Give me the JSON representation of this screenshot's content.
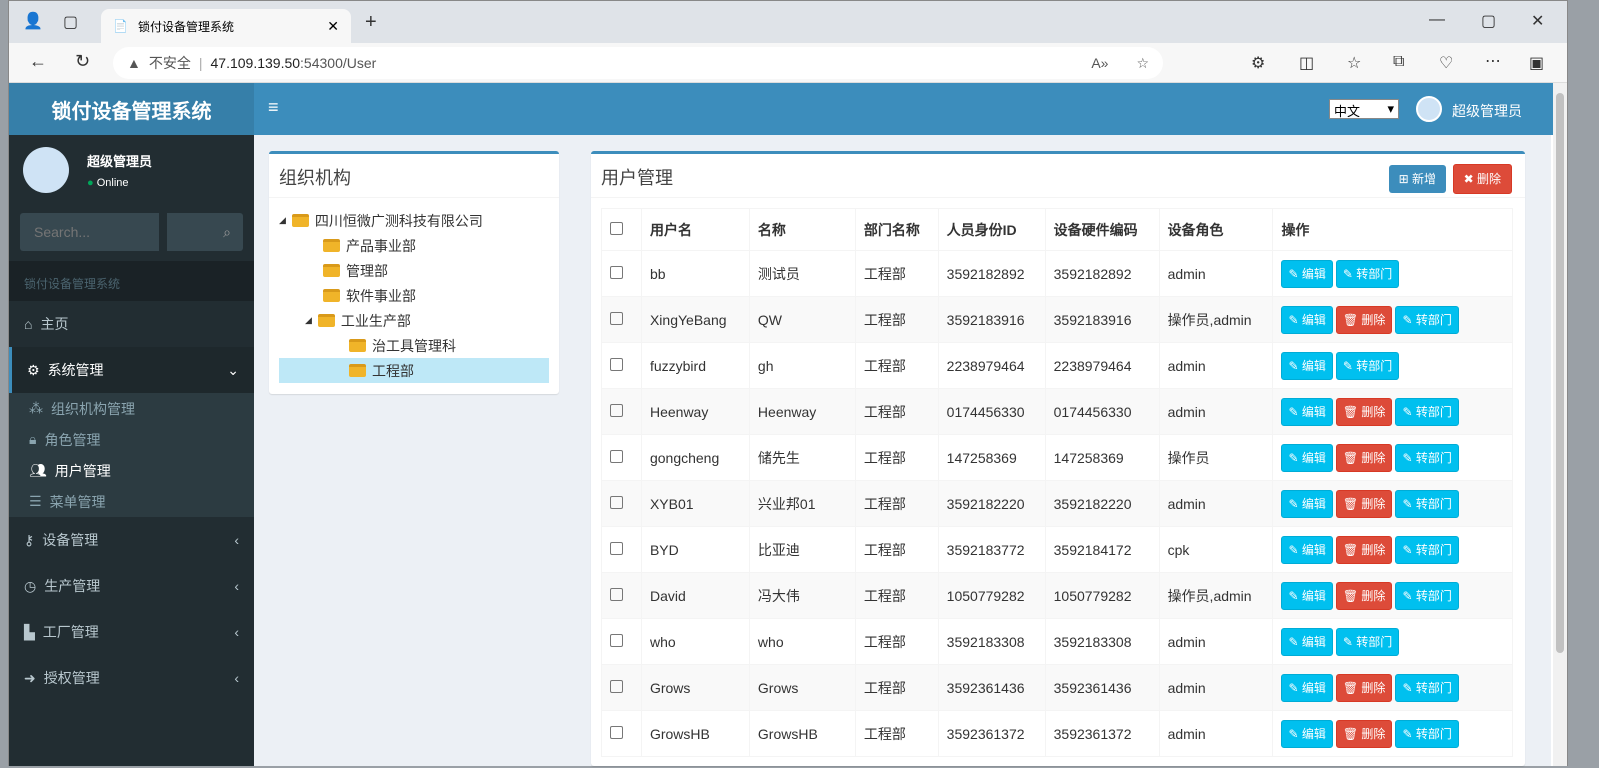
{
  "browser": {
    "tab_title": "锁付设备管理系统",
    "security": "不安全",
    "url_host": "47.109.139.50",
    "url_rest": ":54300/User"
  },
  "header": {
    "logo": "锁付设备管理系统",
    "language": "中文",
    "user": "超级管理员"
  },
  "sidebar": {
    "user": "超级管理员",
    "status": "Online",
    "search_placeholder": "Search...",
    "section": "锁付设备管理系统",
    "items": [
      {
        "label": "主页",
        "icon": "home-icon"
      },
      {
        "label": "系统管理",
        "icon": "gear-icon"
      },
      {
        "label": "设备管理",
        "icon": "key-icon"
      },
      {
        "label": "生产管理",
        "icon": "clock-icon"
      },
      {
        "label": "工厂管理",
        "icon": "industry-icon"
      },
      {
        "label": "授权管理",
        "icon": "sign-in-icon"
      }
    ],
    "subitems": [
      {
        "label": "组织机构管理"
      },
      {
        "label": "角色管理"
      },
      {
        "label": "用户管理"
      },
      {
        "label": "菜单管理"
      }
    ]
  },
  "org": {
    "title": "组织机构",
    "nodes": [
      "四川恒微广测科技有限公司",
      "产品事业部",
      "管理部",
      "软件事业部",
      "工业生产部",
      "治工具管理科",
      "工程部"
    ]
  },
  "users": {
    "title": "用户管理",
    "add": "新增",
    "delete": "删除",
    "columns": [
      "用户名",
      "名称",
      "部门名称",
      "人员身份ID",
      "设备硬件编码",
      "设备角色",
      "操作"
    ],
    "actions": {
      "edit": "编辑",
      "delete": "删除",
      "transfer": "转部门"
    },
    "rows": [
      [
        "bb",
        "测试员",
        "工程部",
        "3592182892",
        "3592182892",
        "admin",
        false
      ],
      [
        "XingYeBang",
        "QW",
        "工程部",
        "3592183916",
        "3592183916",
        "操作员,admin",
        true
      ],
      [
        "fuzzybird",
        "gh",
        "工程部",
        "2238979464",
        "2238979464",
        "admin",
        false
      ],
      [
        "Heenway",
        "Heenway",
        "工程部",
        "0174456330",
        "0174456330",
        "admin",
        true
      ],
      [
        "gongcheng",
        "储先生",
        "工程部",
        "147258369",
        "147258369",
        "操作员",
        true
      ],
      [
        "XYB01",
        "兴业邦01",
        "工程部",
        "3592182220",
        "3592182220",
        "admin",
        true
      ],
      [
        "BYD",
        "比亚迪",
        "工程部",
        "3592183772",
        "3592184172",
        "cpk",
        true
      ],
      [
        "David",
        "冯大伟",
        "工程部",
        "1050779282",
        "1050779282",
        "操作员,admin",
        true
      ],
      [
        "who",
        "who",
        "工程部",
        "3592183308",
        "3592183308",
        "admin",
        false
      ],
      [
        "Grows",
        "Grows",
        "工程部",
        "3592361436",
        "3592361436",
        "admin",
        true
      ],
      [
        "GrowsHB",
        "GrowsHB",
        "工程部",
        "3592361372",
        "3592361372",
        "admin",
        true
      ]
    ]
  }
}
